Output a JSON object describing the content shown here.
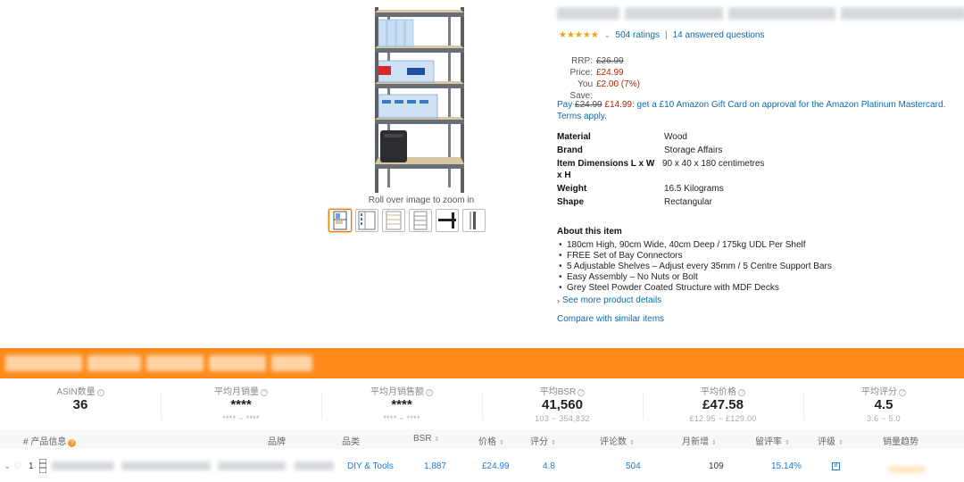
{
  "product": {
    "zoom_hint": "Roll over image to zoom in",
    "ratings_count": "504 ratings",
    "answered_questions": "14 answered questions",
    "rating_stars": "★★★★★",
    "rating_value": 4.8,
    "price": {
      "rrp_label": "RRP:",
      "rrp_value": "£26.99",
      "price_label": "Price:",
      "price_value": "£24.99",
      "save_label": "You Save:",
      "save_value": "£2.00 (7%)"
    },
    "promo": {
      "pay_text": "Pay",
      "old_price": "£24.99",
      "new_price": "£14.99",
      "offer_text": ": get a £10 Amazon Gift Card on approval for the Amazon Platinum Mastercard.",
      "terms": "Terms apply."
    },
    "specs": [
      {
        "key": "Material",
        "value": "Wood"
      },
      {
        "key": "Brand",
        "value": "Storage Affairs"
      },
      {
        "key": "Item Dimensions L x W x H",
        "value": "90 x 40 x 180 centimetres"
      },
      {
        "key": "Weight",
        "value": "16.5 Kilograms"
      },
      {
        "key": "Shape",
        "value": "Rectangular"
      }
    ],
    "about": {
      "heading": "About this item",
      "bullets": [
        "180cm High, 90cm Wide, 40cm Deep / 175kg UDL Per Shelf",
        "FREE Set of Bay Connectors",
        "5 Adjustable Shelves – Adjust every 35mm / 5 Centre Support Bars",
        "Easy Assembly – No Nuts or Bolt",
        "Grey Steel Powder Coated Structure with MDF Decks"
      ],
      "see_more": "See more product details",
      "compare": "Compare with similar items"
    }
  },
  "plugin": {
    "accent": "#ff8a1a",
    "stats": [
      {
        "label": "ASIN数量",
        "value": "36",
        "range": ""
      },
      {
        "label": "平均月销量",
        "value": "****",
        "range": "**** ~ ****"
      },
      {
        "label": "平均月销售额",
        "value": "****",
        "range": "**** ~ ****"
      },
      {
        "label": "平均BSR",
        "value": "41,560",
        "range": "103 ~ 354,832"
      },
      {
        "label": "平均价格",
        "value": "£47.58",
        "range": "£12.95 ~ £129.00"
      },
      {
        "label": "平均评分",
        "value": "4.5",
        "range": "3.6 ~ 5.0"
      }
    ],
    "columns": {
      "hash": "#",
      "info": "产品信息",
      "brand": "品牌",
      "category": "品类",
      "bsr": "BSR",
      "price": "价格",
      "rating": "评分",
      "reviews": "评论数",
      "monthly_new": "月新增",
      "review_rate": "留评率",
      "grade": "评级",
      "trend": "销量趋势"
    },
    "row": {
      "index": "1",
      "category": "DIY & Tools",
      "bsr": "1,887",
      "price": "£24.99",
      "rating": "4.8",
      "reviews": "504",
      "monthly_new": "109",
      "review_rate": "15.14%"
    }
  }
}
